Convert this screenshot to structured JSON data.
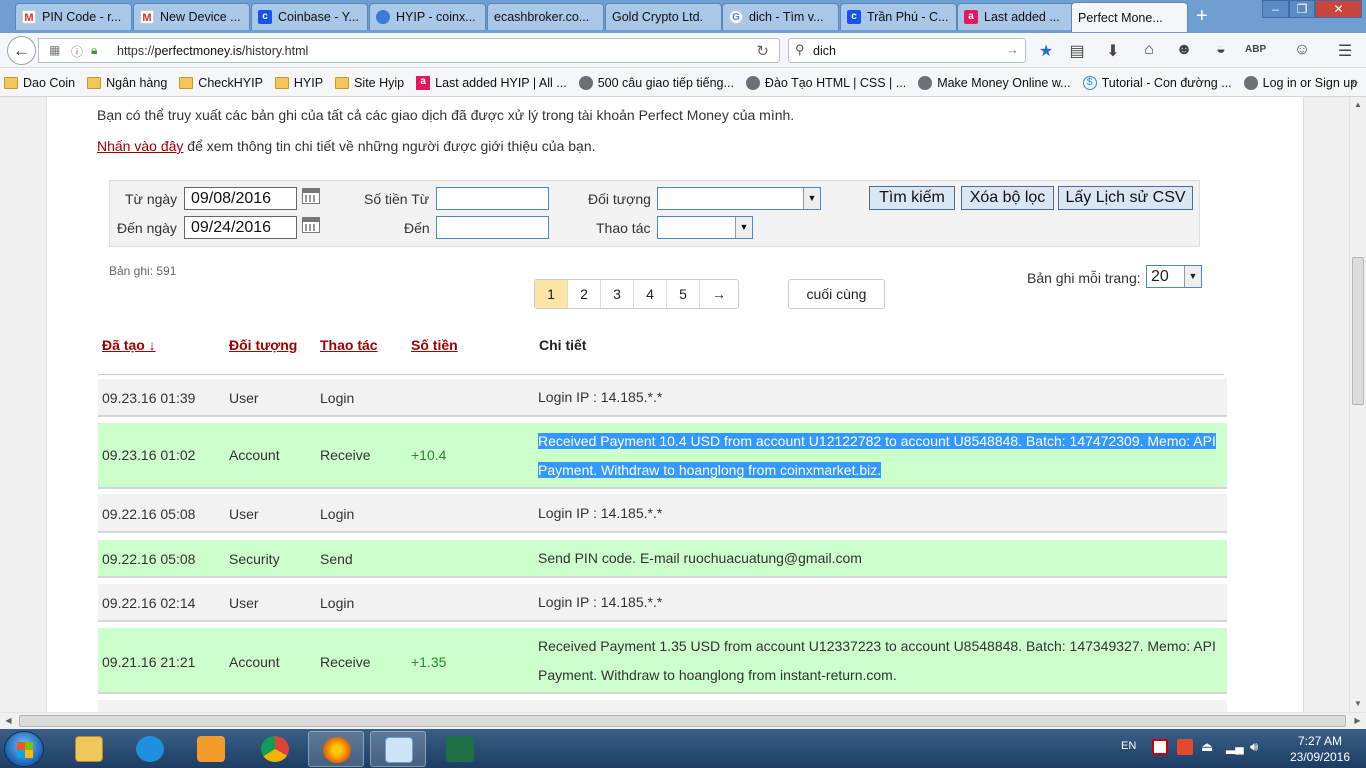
{
  "browser": {
    "tabs": [
      {
        "label": "PIN Code - r...",
        "icon": "gmail-icon"
      },
      {
        "label": "New Device ...",
        "icon": "gmail-icon"
      },
      {
        "label": "Coinbase - Y...",
        "icon": "coinbase-icon"
      },
      {
        "label": "HYIP - coinx...",
        "icon": "globe-icon"
      },
      {
        "label": "ecashbroker.co...",
        "icon": ""
      },
      {
        "label": "Gold Crypto Ltd.",
        "icon": ""
      },
      {
        "label": "dich - Tìm v...",
        "icon": "google-icon"
      },
      {
        "label": "Trần Phú - C...",
        "icon": "coinbase-icon"
      },
      {
        "label": "Last added ...",
        "icon": "a-icon"
      },
      {
        "label": "Perfect Mone...",
        "icon": ""
      }
    ],
    "new_tab": "+",
    "url_scheme": "https://",
    "url_host": "perfectmoney.is",
    "url_path": "/history.html",
    "search_value": "dich",
    "bookmarks": [
      {
        "label": "Dao Coin",
        "icon": "folder"
      },
      {
        "label": "Ngân hàng",
        "icon": "folder"
      },
      {
        "label": "CheckHYIP",
        "icon": "folder"
      },
      {
        "label": "HYIP",
        "icon": "folder"
      },
      {
        "label": "Site Hyip",
        "icon": "folder"
      },
      {
        "label": "Last added HYIP | All ...",
        "icon": "a"
      },
      {
        "label": "500 câu giao tiếp tiếng...",
        "icon": "globe"
      },
      {
        "label": "Đào Tạo HTML | CSS | ...",
        "icon": "globe"
      },
      {
        "label": "Make Money Online w...",
        "icon": "globe"
      },
      {
        "label": "Tutorial - Con đường ...",
        "icon": "dollar"
      },
      {
        "label": "Log in or Sign up",
        "icon": "globe"
      }
    ],
    "bookmarks_overflow": "»"
  },
  "page": {
    "intro_text": "Bạn có thể truy xuất các bản ghi của tất cả các giao dịch đã được xử lý trong tài khoản Perfect Money của mình.",
    "referral_link": "Nhấn vào đây",
    "referral_rest": " để xem thông tin chi tiết về những người được giới thiệu của bạn.",
    "filter": {
      "from_date_label": "Từ ngày",
      "from_date_value": "09/08/2016",
      "to_date_label": "Đến ngày",
      "to_date_value": "09/24/2016",
      "amount_from_label": "Số tiền Từ",
      "amount_to_label": "Đến",
      "object_label": "Đối tượng",
      "action_label": "Thao tác",
      "search_button": "Tìm kiếm",
      "clear_button": "Xóa bộ lọc",
      "csv_button": "Lấy Lịch sử CSV"
    },
    "records_label": "Bản ghi: 591",
    "pager": {
      "pages": [
        "1",
        "2",
        "3",
        "4",
        "5"
      ],
      "next": "→",
      "active": "1",
      "last": "cuối cùng"
    },
    "per_page_label": "Bản ghi mỗi trang:",
    "per_page_value": "20",
    "columns": {
      "created": "Đã tạo ↓",
      "object": "Đối tượng",
      "action": "Thao tác",
      "amount": "Số tiền",
      "details": "Chi tiết"
    },
    "rows": [
      {
        "created": "09.23.16 01:39",
        "object": "User",
        "action": "Login",
        "amount": "",
        "details": "Login IP : 14.185.*.*",
        "style": "gray"
      },
      {
        "created": "09.23.16 01:02",
        "object": "Account",
        "action": "Receive",
        "amount": "+10.4",
        "details": "Received Payment 10.4 USD from account U12122782 to account U8548848. Batch: 147472309. Memo: API Payment. Withdraw to hoanglong from coinxmarket.biz.",
        "style": "green",
        "selected": true
      },
      {
        "created": "09.22.16 05:08",
        "object": "User",
        "action": "Login",
        "amount": "",
        "details": "Login IP : 14.185.*.*",
        "style": "gray"
      },
      {
        "created": "09.22.16 05:08",
        "object": "Security",
        "action": "Send",
        "amount": "",
        "details": "Send PIN code. E-mail ruochuacuatung@gmail.com",
        "style": "green"
      },
      {
        "created": "09.22.16 02:14",
        "object": "User",
        "action": "Login",
        "amount": "",
        "details": "Login IP : 14.185.*.*",
        "style": "gray"
      },
      {
        "created": "09.21.16 21:21",
        "object": "Account",
        "action": "Receive",
        "amount": "+1.35",
        "details": "Received Payment 1.35 USD from account U12337223 to account U8548848. Batch: 147349327. Memo: API Payment. Withdraw to hoanglong from instant-return.com.",
        "style": "green"
      }
    ]
  },
  "taskbar": {
    "apps": [
      "file-explorer-icon",
      "internet-explorer-icon",
      "media-player-icon",
      "chrome-icon",
      "firefox-icon",
      "paint-icon",
      "excel-icon"
    ],
    "language": "EN",
    "time": "7:27 AM",
    "date": "23/09/2016"
  }
}
